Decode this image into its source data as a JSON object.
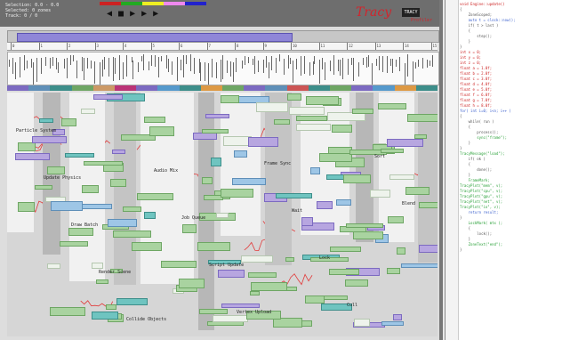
{
  "colors": {
    "accent_range": "#8f86d8",
    "green_block": "#a9d3a0",
    "purple_block": "#b7a6e0",
    "blue_block": "#9ec6e6",
    "teal_block": "#6fc4c0",
    "trace_red": "#e23a3a",
    "logo_red": "#d2242c"
  },
  "topbar": {
    "status_lines": [
      "Selection: 0.0 - 0.0",
      "Selected: 0 zones",
      "Track: 0 / 0"
    ],
    "swatches": [
      "#c22",
      "#2a2",
      "#ee2",
      "#e8e",
      "#22c"
    ],
    "transport_icons": [
      "prev-frame-icon",
      "stop-icon",
      "play-icon",
      "step-icon",
      "next-frame-icon"
    ],
    "transport_glyphs": [
      "◀",
      "■",
      "▶",
      "▶",
      "▶"
    ]
  },
  "logo": {
    "text": "Tracy",
    "box": "TRACY",
    "sub": "Profiler"
  },
  "ruler": {
    "ticks": [
      "0",
      "1",
      "2",
      "3",
      "4",
      "5",
      "6",
      "7",
      "8",
      "9",
      "10",
      "11",
      "12",
      "13",
      "14",
      "15"
    ]
  },
  "flame_labels": [
    "Particle System",
    "Update Physics",
    "Draw Batch",
    "Render Scene",
    "Collide Objects",
    "Audio Mix",
    "Job Queue",
    "Script Update",
    "Vertex Upload",
    "Frame Sync",
    "Wait",
    "Lock",
    "Cull",
    "Sort",
    "Blend"
  ],
  "code_lines": [
    {
      "c": "kw",
      "t": "void Engine::update()"
    },
    {
      "c": "pl",
      "t": "{"
    },
    {
      "c": "pl",
      "t": "    ZoneScoped;"
    },
    {
      "c": "nm",
      "t": "    auto t = clock::now();"
    },
    {
      "c": "pl",
      "t": "    if( t > last )"
    },
    {
      "c": "pl",
      "t": "    {"
    },
    {
      "c": "pl",
      "t": "        step();"
    },
    {
      "c": "pl",
      "t": "    }"
    },
    {
      "c": "pl",
      "t": "}"
    },
    {
      "c": "kw",
      "t": "int x = 0;"
    },
    {
      "c": "kw",
      "t": "int y = 0;"
    },
    {
      "c": "kw",
      "t": "int z = 0;"
    },
    {
      "c": "pl",
      "t": ""
    },
    {
      "c": "kw",
      "t": "float a = 1.0f;"
    },
    {
      "c": "kw",
      "t": "float b = 2.0f;"
    },
    {
      "c": "kw",
      "t": "float c = 3.0f;"
    },
    {
      "c": "kw",
      "t": "float d = 4.0f;"
    },
    {
      "c": "kw",
      "t": "float e = 5.0f;"
    },
    {
      "c": "kw",
      "t": "float f = 6.0f;"
    },
    {
      "c": "kw",
      "t": "float g = 7.0f;"
    },
    {
      "c": "kw",
      "t": "float h = 8.0f;"
    },
    {
      "c": "pl",
      "t": ""
    },
    {
      "c": "nm",
      "t": "for( int i=0; i<n; i++ )"
    },
    {
      "c": "pl",
      "t": "{"
    },
    {
      "c": "pl",
      "t": "    while( run )"
    },
    {
      "c": "pl",
      "t": "    {"
    },
    {
      "c": "pl",
      "t": "        process();"
    },
    {
      "c": "str",
      "t": "        sync(\"frame\");"
    },
    {
      "c": "pl",
      "t": "    }"
    },
    {
      "c": "pl",
      "t": "}"
    },
    {
      "c": "pl",
      "t": ""
    },
    {
      "c": "str",
      "t": "TracyMessage(\"load\");"
    },
    {
      "c": "pl",
      "t": "    if( ok )"
    },
    {
      "c": "pl",
      "t": "    {"
    },
    {
      "c": "pl",
      "t": "        done();"
    },
    {
      "c": "pl",
      "t": "    }"
    },
    {
      "c": "str",
      "t": "    FrameMark;"
    },
    {
      "c": "pl",
      "t": ""
    },
    {
      "c": "str",
      "t": "TracyPlot(\"mem\", v);"
    },
    {
      "c": "str",
      "t": "TracyPlot(\"cpu\", v);"
    },
    {
      "c": "str",
      "t": "TracyPlot(\"gpu\", v);"
    },
    {
      "c": "str",
      "t": "TracyPlot(\"net\", v);"
    },
    {
      "c": "str",
      "t": "TracyPlot(\"io\", v);"
    },
    {
      "c": "pl",
      "t": ""
    },
    {
      "c": "nm",
      "t": "    return result;"
    },
    {
      "c": "pl",
      "t": "}"
    },
    {
      "c": "pl",
      "t": ""
    },
    {
      "c": "str",
      "t": "    LockMark( mtx );"
    },
    {
      "c": "pl",
      "t": "    {"
    },
    {
      "c": "pl",
      "t": "        lock();"
    },
    {
      "c": "pl",
      "t": "    }"
    },
    {
      "c": "str",
      "t": "    ZoneText(\"end\");"
    },
    {
      "c": "pl",
      "t": "}"
    }
  ]
}
